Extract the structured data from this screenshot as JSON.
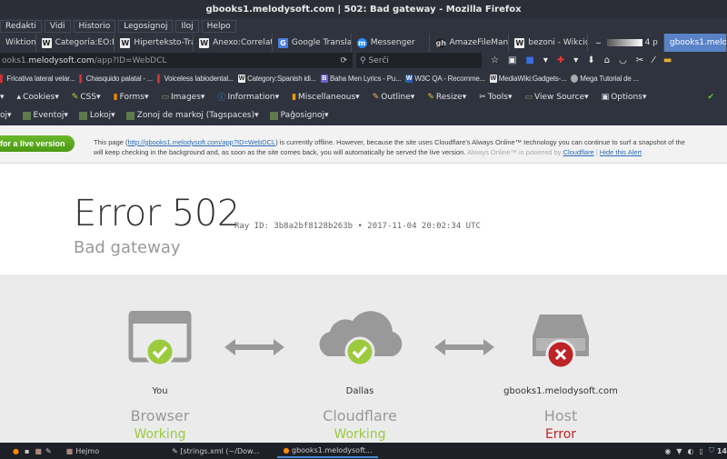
{
  "window": {
    "title": "gbooks1.melodysoft.com | 502: Bad gateway - Mozilla Firefox"
  },
  "menu": [
    "Redakti",
    "Vidi",
    "Historio",
    "Legosignoj",
    "Iloj",
    "Helpo"
  ],
  "tabs": [
    {
      "icon": "W",
      "label": "Wiktion"
    },
    {
      "icon": "W",
      "label": "Categoría:EO:Pr"
    },
    {
      "icon": "W",
      "label": "Hiperteksto-Tra"
    },
    {
      "icon": "W",
      "label": "Anexo:Correlati"
    },
    {
      "icon": "G",
      "label": "Google Translat"
    },
    {
      "icon": "m",
      "label": "Messenger"
    },
    {
      "icon": "gh",
      "label": "AmazeFileMana"
    },
    {
      "icon": "W",
      "label": "bezoni - Wikcion"
    },
    {
      "icon": "~",
      "label": "4 p"
    },
    {
      "icon": "",
      "label": "gbooks1.melodysoft",
      "active": true
    }
  ],
  "url": {
    "host_prefix": "ooks1.",
    "host": "melodysoft.com",
    "path": "/app?ID=WebDCL",
    "reload": "⟳",
    "search_placeholder": "Serĉi"
  },
  "bookmarks": [
    "Fricativa lateral velar...",
    "Chasquido palatal - ...",
    "Voiceless labiodental...",
    "Category:Spanish idi...",
    "Baha Men Lyrics - Pu...",
    "W3C QA - Recomme...",
    "MediaWiki:Gadgets-...",
    "Mega Tutorial de ..."
  ],
  "webdev": [
    "Cookies",
    "CSS",
    "Forms",
    "Images",
    "Information",
    "Miscellaneous",
    "Outline",
    "Resize",
    "Tools",
    "View Source",
    "Options"
  ],
  "tags": [
    "oj",
    "Eventoj",
    "Lokoj",
    "Zonoj de markoj (Tagspaces)",
    "Paĝosignoj"
  ],
  "alert": {
    "button": "for a live version",
    "line1_pre": "This page (",
    "link": "http://gbooks1.melodysoft.com/app?ID=WebDCL",
    "line1_post": ") is currently offline. However, because the site uses Cloudflare's Always Online™ technology you can continue to surf a snapshot of the",
    "line2": "will keep checking in the background and, as soon as the site comes back, you will automatically be served the live version.",
    "powered": "Always Online™ is powered by",
    "cloudflare": "Cloudflare",
    "sep": "|",
    "hide": "Hide this Alert"
  },
  "error": {
    "title": "Error 502",
    "ray": "Ray ID: 3b8a2bf8128b263b • 2017-11-04 20:02:34 UTC",
    "subtitle": "Bad gateway"
  },
  "nodes": [
    {
      "label": "You",
      "name": "Browser",
      "status": "Working",
      "ok": true
    },
    {
      "label": "Dallas",
      "name": "Cloudflare",
      "status": "Working",
      "ok": true
    },
    {
      "label": "gbooks1.melodysoft.com",
      "name": "Host",
      "status": "Error",
      "ok": false
    }
  ],
  "colors": {
    "ok": "#9bca3e",
    "error": "#bd2426",
    "accent": "#5a82c6"
  },
  "taskbar": {
    "items": [
      "Hejmo",
      "[strings.xml (~/Dow...",
      "gbooks1.melodysoft..."
    ],
    "clock": "14"
  }
}
